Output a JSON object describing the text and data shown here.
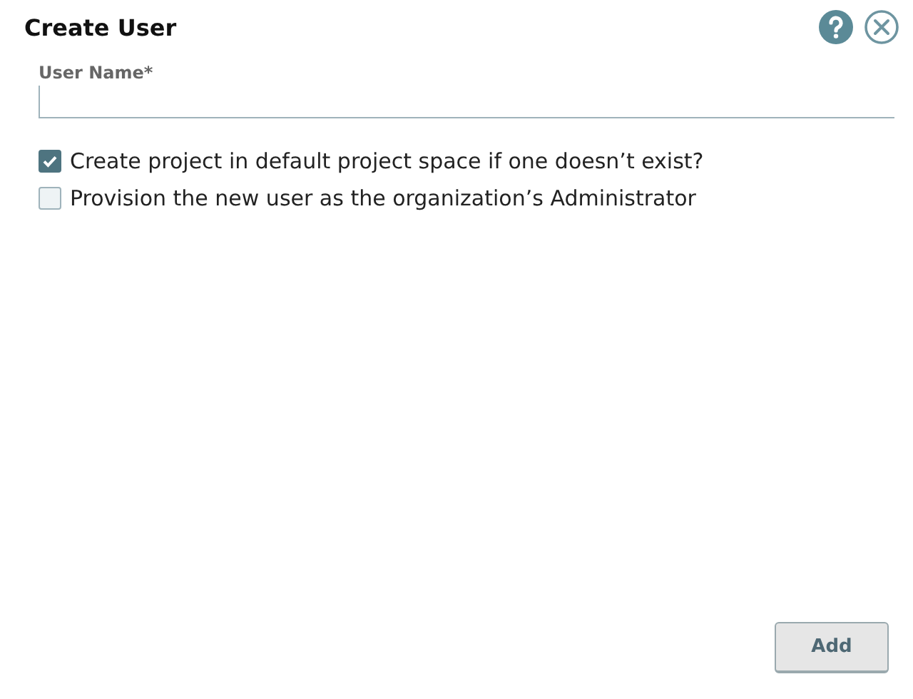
{
  "dialog": {
    "title": "Create User"
  },
  "fields": [
    {
      "label": "User Name*"
    }
  ],
  "options": [
    {
      "label": "Create project in default project space if one doesn’t exist?",
      "checked": true
    },
    {
      "label": "Provision the new user as the organization’s Administrator",
      "checked": false
    }
  ],
  "buttons": [
    {
      "label": "Add"
    }
  ]
}
